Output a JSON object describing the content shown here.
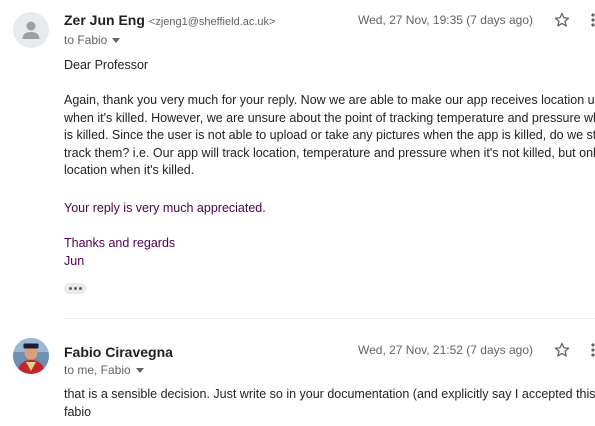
{
  "messages": [
    {
      "sender_name": "Zer Jun Eng",
      "sender_email": "<zjeng1@sheffield.ac.uk>",
      "to_line": "to Fabio",
      "date": "Wed, 27 Nov, 19:35 (7 days ago)",
      "body_greeting": "Dear Professor",
      "body_lines": [
        "Again, thank you very much for your reply. Now we are able to make our app receives location upd",
        "when it's killed. However, we are unsure about the point of tracking temperature and pressure whe",
        "is killed. Since the user is not able to upload or take any pictures when the app is killed, do we still",
        "track them? i.e. Our app will track location, temperature and pressure when it's not killed, but only",
        "location when it's killed."
      ],
      "appreciation": "Your reply is very  much appreciated.",
      "signoff": "Thanks and regards",
      "signature": "Jun"
    },
    {
      "sender_name": "Fabio Ciravegna",
      "to_line": "to me, Fabio",
      "date": "Wed, 27 Nov, 21:52 (7 days ago)",
      "body_line": "that is a sensible decision. Just write so in your documentation (and explicitly say I accepted this).",
      "signature": "fabio"
    }
  ],
  "icons": {
    "star": "star-outline-icon",
    "more": "more-vert-icon",
    "avatar_default": "person-icon",
    "expand": "trimmed-content-dots-icon"
  },
  "colors": {
    "quoted_text": "#500050",
    "meta_text": "#5f6368"
  }
}
